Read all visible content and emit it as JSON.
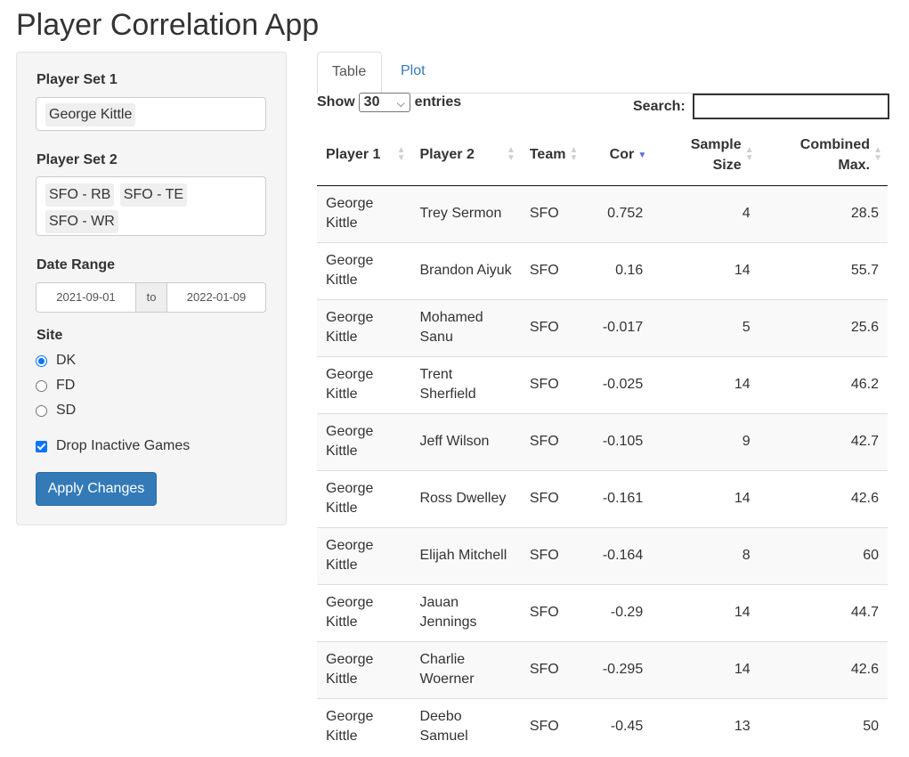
{
  "app": {
    "title": "Player Correlation App"
  },
  "sidebar": {
    "player_set_1": {
      "label": "Player Set 1",
      "chips": [
        "George Kittle"
      ]
    },
    "player_set_2": {
      "label": "Player Set 2",
      "chips": [
        "SFO - RB",
        "SFO - TE",
        "SFO - WR"
      ]
    },
    "date_range": {
      "label": "Date Range",
      "start": "2021-09-01",
      "separator": "to",
      "end": "2022-01-09"
    },
    "site": {
      "label": "Site",
      "options": [
        "DK",
        "FD",
        "SD"
      ],
      "selected": "DK"
    },
    "drop_inactive": {
      "label": "Drop Inactive Games",
      "checked": true
    },
    "apply_button": "Apply Changes"
  },
  "tabs": [
    {
      "label": "Table",
      "active": true
    },
    {
      "label": "Plot",
      "active": false
    }
  ],
  "table_controls": {
    "show_label": "Show",
    "entries_value": "30",
    "entries_label": "entries",
    "search_label": "Search:"
  },
  "table": {
    "columns": [
      "Player 1",
      "Player 2",
      "Team",
      "Cor",
      "Sample Size",
      "Combined Max."
    ],
    "sorted_column": "Cor",
    "sort_direction": "desc",
    "rows": [
      {
        "p1": "George Kittle",
        "p2": "Trey Sermon",
        "team": "SFO",
        "cor": "0.752",
        "n": "4",
        "max": "28.5"
      },
      {
        "p1": "George Kittle",
        "p2": "Brandon Aiyuk",
        "team": "SFO",
        "cor": "0.16",
        "n": "14",
        "max": "55.7"
      },
      {
        "p1": "George Kittle",
        "p2": "Mohamed Sanu",
        "team": "SFO",
        "cor": "-0.017",
        "n": "5",
        "max": "25.6"
      },
      {
        "p1": "George Kittle",
        "p2": "Trent Sherfield",
        "team": "SFO",
        "cor": "-0.025",
        "n": "14",
        "max": "46.2"
      },
      {
        "p1": "George Kittle",
        "p2": "Jeff Wilson",
        "team": "SFO",
        "cor": "-0.105",
        "n": "9",
        "max": "42.7"
      },
      {
        "p1": "George Kittle",
        "p2": "Ross Dwelley",
        "team": "SFO",
        "cor": "-0.161",
        "n": "14",
        "max": "42.6"
      },
      {
        "p1": "George Kittle",
        "p2": "Elijah Mitchell",
        "team": "SFO",
        "cor": "-0.164",
        "n": "8",
        "max": "60"
      },
      {
        "p1": "George Kittle",
        "p2": "Jauan Jennings",
        "team": "SFO",
        "cor": "-0.29",
        "n": "14",
        "max": "44.7"
      },
      {
        "p1": "George Kittle",
        "p2": "Charlie Woerner",
        "team": "SFO",
        "cor": "-0.295",
        "n": "14",
        "max": "42.6"
      },
      {
        "p1": "George Kittle",
        "p2": "Deebo Samuel",
        "team": "SFO",
        "cor": "-0.45",
        "n": "13",
        "max": "50"
      }
    ]
  }
}
